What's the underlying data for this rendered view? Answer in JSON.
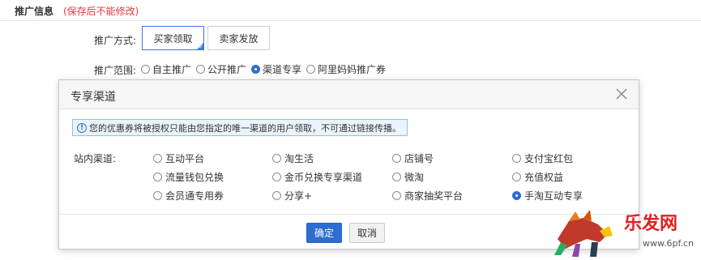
{
  "section": {
    "title": "推广信息",
    "note": "(保存后不能修改)"
  },
  "method": {
    "label": "推广方式:",
    "options": [
      "买家领取",
      "卖家发放"
    ],
    "selected": "买家领取"
  },
  "scope": {
    "label": "推广范围:",
    "options": [
      {
        "label": "自主推广",
        "checked": false
      },
      {
        "label": "公开推广",
        "checked": false
      },
      {
        "label": "渠道专享",
        "checked": true
      },
      {
        "label": "阿里妈妈推广券",
        "checked": false
      }
    ]
  },
  "modal": {
    "title": "专享渠道",
    "notice": "您的优惠券将被授权只能由您指定的唯一渠道的用户领取，不可通过链接传播。",
    "channel_label": "站内渠道:",
    "channels": [
      {
        "label": "互动平台",
        "checked": false
      },
      {
        "label": "淘生活",
        "checked": false
      },
      {
        "label": "店铺号",
        "checked": false
      },
      {
        "label": "支付宝红包",
        "checked": false
      },
      {
        "label": "流量钱包兑换",
        "checked": false
      },
      {
        "label": "金币兑换专享渠道",
        "checked": false
      },
      {
        "label": "微淘",
        "checked": false
      },
      {
        "label": "充值权益",
        "checked": false
      },
      {
        "label": "会员通专用券",
        "checked": false
      },
      {
        "label": "分享+",
        "checked": false
      },
      {
        "label": "商家抽奖平台",
        "checked": false
      },
      {
        "label": "手淘互动专享",
        "checked": true
      }
    ],
    "ok_label": "确定",
    "cancel_label": "取消"
  },
  "watermark": {
    "logo_text": "乐发网",
    "url": "www.6pf.cn"
  },
  "colors": {
    "accent": "#2e6dd2",
    "warning": "#e4393c",
    "notice_bg": "#eaf4fc"
  }
}
